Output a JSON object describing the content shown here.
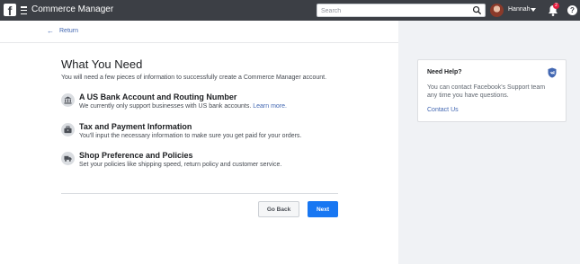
{
  "app": {
    "title": "Commerce Manager"
  },
  "topbar": {
    "search_placeholder": "Search",
    "user_name": "Hannah",
    "notification_count": "2",
    "help_label": "?"
  },
  "nav": {
    "return_label": "Return"
  },
  "page": {
    "heading": "What You Need",
    "intro": "You will need a few pieces of information to successfully create a Commerce Manager account."
  },
  "requirements": [
    {
      "title": "A US Bank Account and Routing Number",
      "desc": "We currently only support businesses with US bank accounts.",
      "link": "Learn more.",
      "icon": "bank-icon"
    },
    {
      "title": "Tax and Payment Information",
      "desc": "You'll input the necessary information to make sure you get paid for your orders.",
      "icon": "briefcase-icon"
    },
    {
      "title": "Shop Preference and Policies",
      "desc": "Set your policies like shipping speed, return policy and customer service.",
      "icon": "truck-icon"
    }
  ],
  "buttons": {
    "back": "Go Back",
    "next": "Next"
  },
  "help": {
    "title": "Need Help?",
    "text": "You can contact Facebook's Support team any time you have questions.",
    "link": "Contact Us"
  },
  "colors": {
    "topbar": "#3c3f45",
    "primary": "#1877f2",
    "link": "#4267b2",
    "sidebar_bg": "#f0f2f5"
  }
}
